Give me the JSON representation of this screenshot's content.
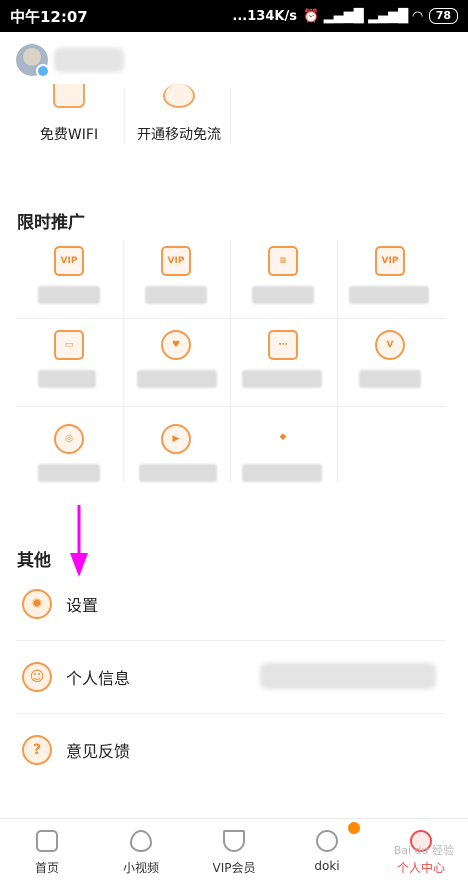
{
  "status_bar": {
    "time": "中午12:07",
    "speed": "...134K/s",
    "signal": "⏰ ▂▄▆█ ▂▄▆█ ◠",
    "battery": "78"
  },
  "top_items": [
    {
      "label": "免费WIFI"
    },
    {
      "label": "开通移动免流"
    }
  ],
  "sections": {
    "promo_title": "限时推广",
    "other_title": "其他"
  },
  "promo_icons": [
    {
      "icon": "gift-vip-icon",
      "glyph": "VIP"
    },
    {
      "icon": "vip-card-icon",
      "glyph": "VIP"
    },
    {
      "icon": "card-icon",
      "glyph": "≡"
    },
    {
      "icon": "vip-ticket-icon",
      "glyph": "VIP"
    },
    {
      "icon": "coupon-icon",
      "glyph": "▭"
    },
    {
      "icon": "heart-coin-icon",
      "glyph": "♥"
    },
    {
      "icon": "ticket-icon",
      "glyph": "⋯"
    },
    {
      "icon": "v-badge-icon",
      "glyph": "V"
    },
    {
      "icon": "mascot-icon",
      "glyph": "◎"
    },
    {
      "icon": "play-circle-icon",
      "glyph": "▶"
    },
    {
      "icon": "checker-icon",
      "glyph": "◆"
    }
  ],
  "list": [
    {
      "label": "设置",
      "icon": "gear-icon",
      "glyph": "✹"
    },
    {
      "label": "个人信息",
      "icon": "user-face-icon",
      "glyph": "☺"
    },
    {
      "label": "意见反馈",
      "icon": "question-icon",
      "glyph": "?"
    }
  ],
  "bottom_nav": [
    {
      "label": "首页",
      "icon": "home-icon"
    },
    {
      "label": "小视频",
      "icon": "drop-icon"
    },
    {
      "label": "VIP会员",
      "icon": "vip-crown-icon"
    },
    {
      "label": "doki",
      "icon": "doki-heart-icon"
    },
    {
      "label": "个人中心",
      "icon": "profile-face-icon"
    }
  ],
  "watermark": "Bai du 经验",
  "colors": {
    "accent": "#f59a4c",
    "active": "#f24b4b",
    "arrow": "#ff00ff"
  }
}
